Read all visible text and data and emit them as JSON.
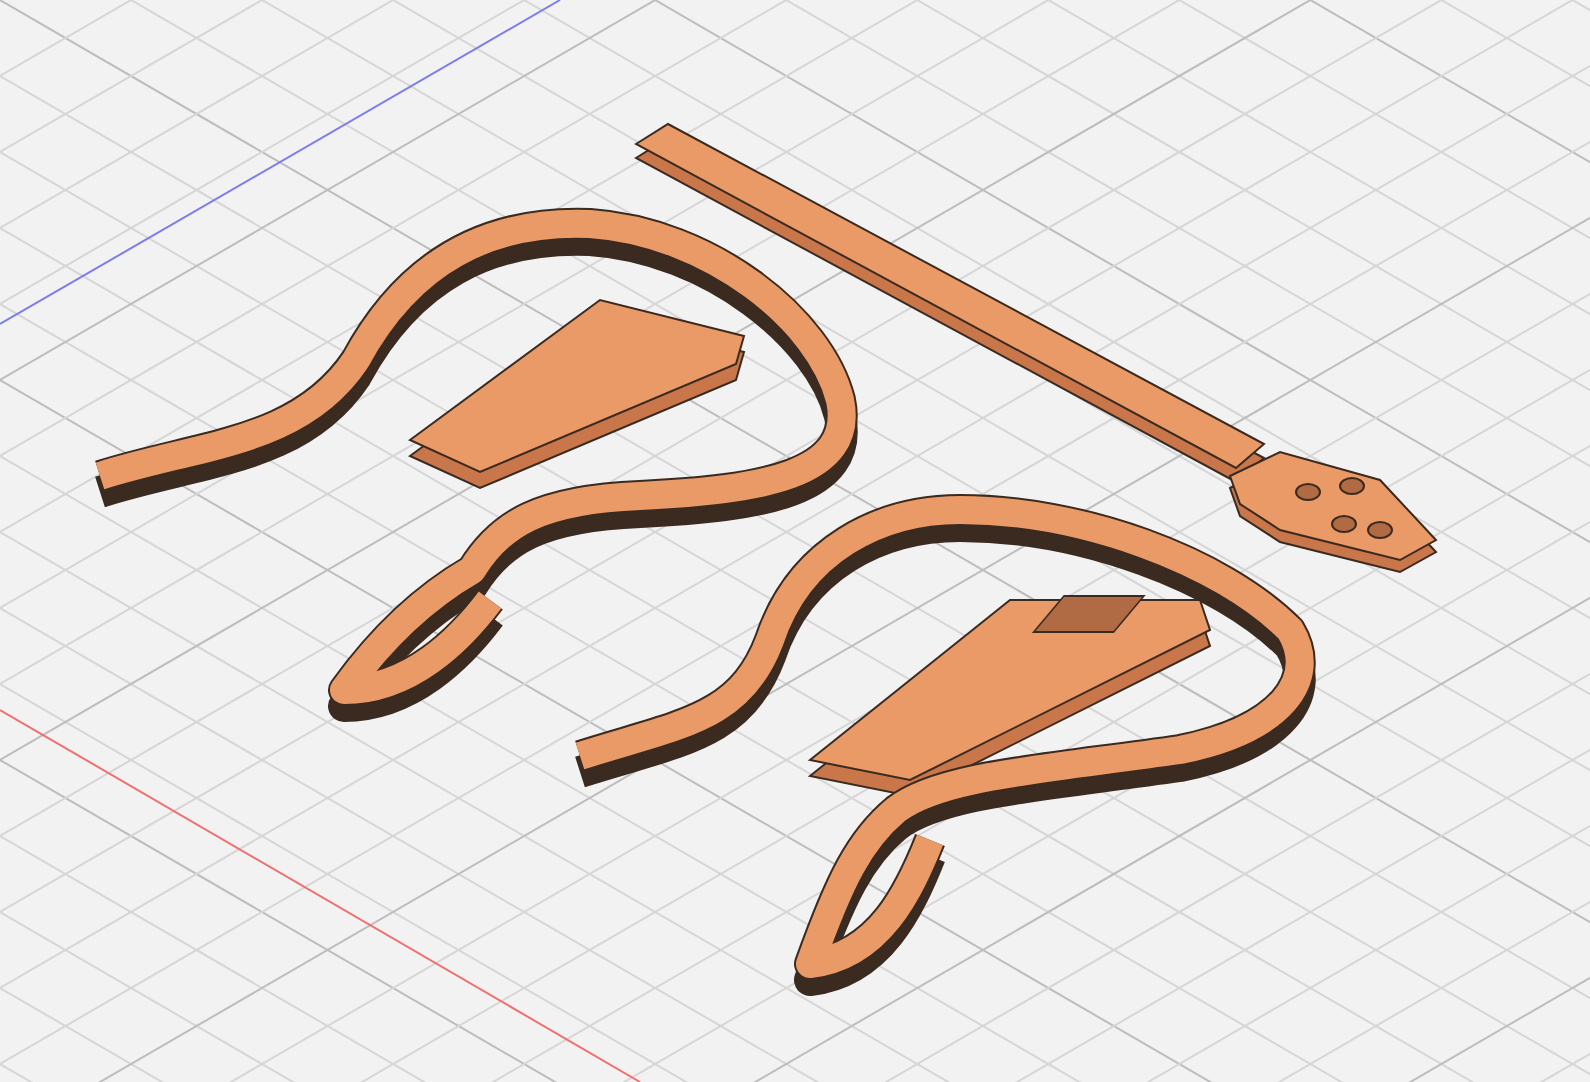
{
  "viewport": {
    "grid": true,
    "axes": true
  },
  "parts": [
    {
      "kind": "body-frame"
    },
    {
      "kind": "body-frame"
    },
    {
      "kind": "neck"
    }
  ]
}
